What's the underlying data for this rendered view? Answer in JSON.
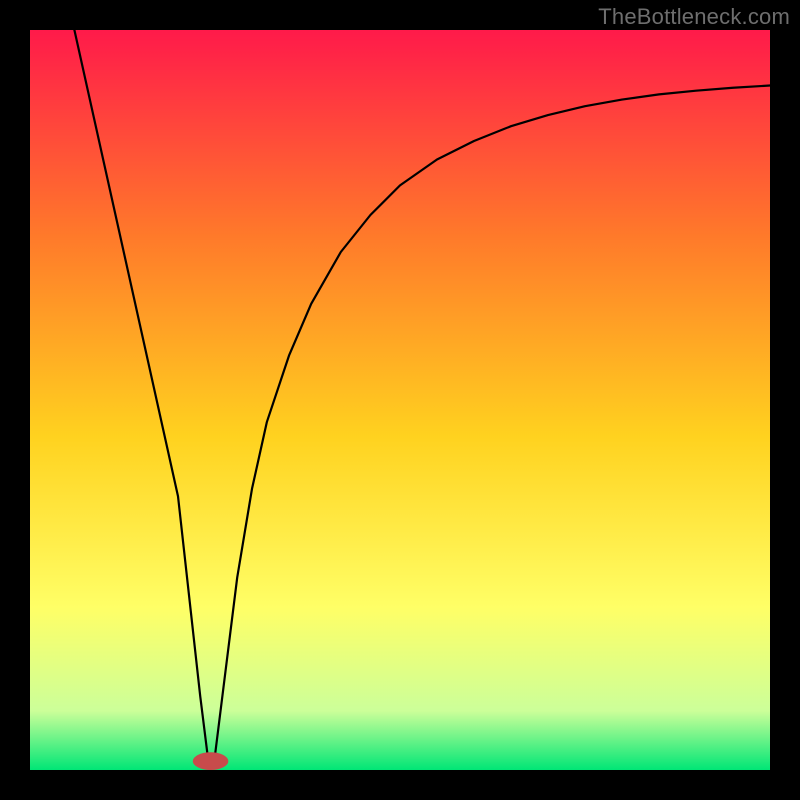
{
  "watermark": "TheBottleneck.com",
  "chart_data": {
    "type": "line",
    "title": "",
    "xlabel": "",
    "ylabel": "",
    "xlim": [
      0,
      100
    ],
    "ylim": [
      0,
      100
    ],
    "grid": false,
    "background_gradient": {
      "top": "#ff1a4a",
      "upper_mid": "#ff7a2a",
      "mid": "#ffd21f",
      "lower_mid": "#ffff66",
      "near_bottom": "#ccff99",
      "bottom": "#00e676"
    },
    "series": [
      {
        "name": "curve",
        "color": "#000000",
        "width": 2.2,
        "x": [
          6,
          8,
          10,
          12,
          14,
          16,
          18,
          20,
          22,
          23,
          24,
          25,
          26,
          28,
          30,
          32,
          35,
          38,
          42,
          46,
          50,
          55,
          60,
          65,
          70,
          75,
          80,
          85,
          90,
          95,
          100
        ],
        "values": [
          100,
          91,
          82,
          73,
          64,
          55,
          46,
          37,
          19,
          10,
          2,
          2,
          10,
          26,
          38,
          47,
          56,
          63,
          70,
          75,
          79,
          82.5,
          85,
          87,
          88.5,
          89.7,
          90.6,
          91.3,
          91.8,
          92.2,
          92.5
        ]
      }
    ],
    "marker": {
      "name": "minimum-pill",
      "shape": "pill",
      "color": "#c84b4b",
      "cx": 24.4,
      "cy": 1.2,
      "rx": 2.4,
      "ry": 1.2
    }
  }
}
